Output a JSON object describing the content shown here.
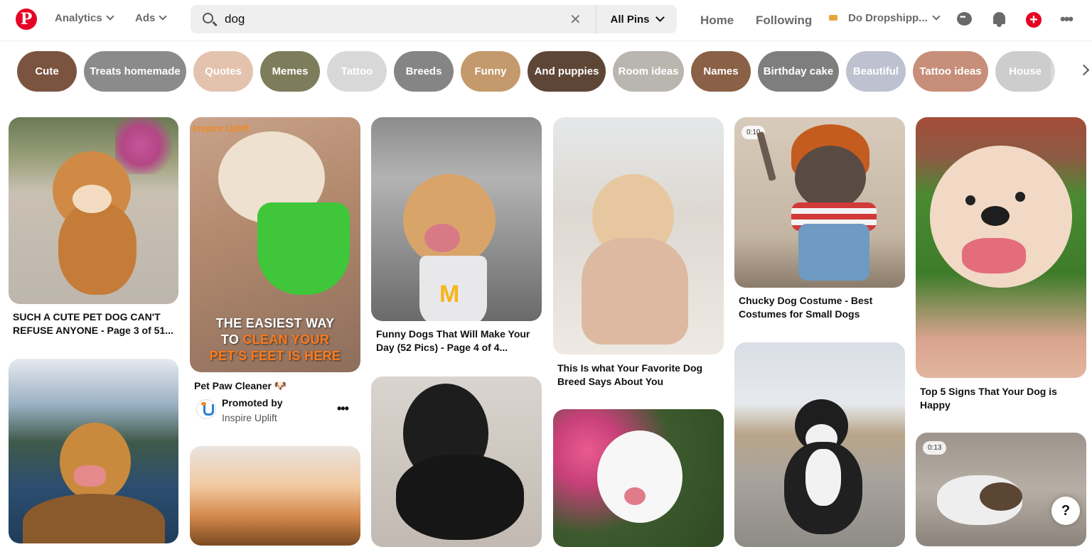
{
  "header": {
    "logo_letter": "P",
    "nav": {
      "analytics": "Analytics",
      "ads": "Ads"
    },
    "search": {
      "query": "dog",
      "placeholder": "Search",
      "filter": "All Pins"
    },
    "links": {
      "home": "Home",
      "following": "Following"
    },
    "account_name": "Do Dropshipp..."
  },
  "chips": [
    {
      "label": "Cute",
      "color": "#7b5440"
    },
    {
      "label": "Treats homemade",
      "color": "#8b8b8b"
    },
    {
      "label": "Quotes",
      "color": "#e4c3ae"
    },
    {
      "label": "Memes",
      "color": "#7d7d5c"
    },
    {
      "label": "Tattoo",
      "color": "#d8d8d8"
    },
    {
      "label": "Breeds",
      "color": "#858585"
    },
    {
      "label": "Funny",
      "color": "#c49a6c"
    },
    {
      "label": "And puppies",
      "color": "#5e4637"
    },
    {
      "label": "Room ideas",
      "color": "#b9b6b0"
    },
    {
      "label": "Names",
      "color": "#8a6046"
    },
    {
      "label": "Birthday cake",
      "color": "#7e7e7e"
    },
    {
      "label": "Beautiful",
      "color": "#bec1cf"
    },
    {
      "label": "Tattoo ideas",
      "color": "#c78e79"
    },
    {
      "label": "House",
      "color": "#cdcdcd"
    }
  ],
  "pins": {
    "p1": {
      "title": "SUCH A CUTE PET DOG CAN'T REFUSE ANYONE - Page 3 of 51..."
    },
    "p2": {
      "title": "Pet Paw Cleaner 🐶",
      "brand": "Inspire Uplift",
      "ad_line1": "THE EASIEST WAY",
      "ad_line2a": "TO ",
      "ad_line2b": "CLEAN YOUR",
      "ad_line3": "PET'S FEET IS HERE",
      "promoted_by": "Promoted by",
      "promoter": "Inspire Uplift"
    },
    "p3": {
      "title": "Funny Dogs That Will Make Your Day (52 Pics) - Page 4 of 4..."
    },
    "p4": {
      "title": "This Is what Your Favorite Dog Breed Says About You"
    },
    "p5": {
      "title": "Chucky Dog Costume - Best Costumes for Small Dogs",
      "duration": "0:10"
    },
    "p6": {
      "title": "Top 5 Signs That Your Dog is Happy"
    },
    "p12": {
      "duration": "0:13"
    }
  },
  "help_label": "?"
}
